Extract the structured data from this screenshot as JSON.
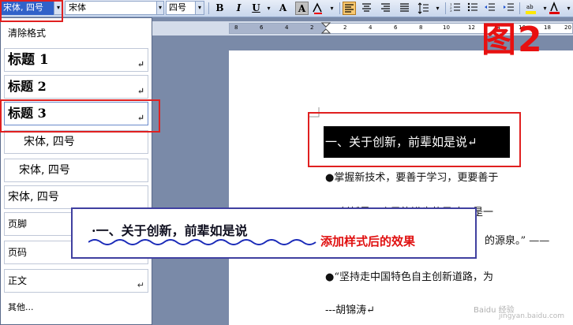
{
  "toolbar": {
    "style_value": "宋体, 四号",
    "font_value": "宋体",
    "size_value": "四号",
    "bold": "B",
    "italic": "I",
    "underline": "U",
    "font_color": "A",
    "char_border": "A",
    "dropdown_arrow": "▾",
    "icons": [
      "bold-icon",
      "italic-icon",
      "underline-icon",
      "font-color-icon",
      "char-shading-icon",
      "highlight-icon",
      "align-left-icon",
      "align-center-icon",
      "align-right-icon",
      "justify-icon",
      "line-spacing-icon",
      "numbering-icon",
      "bullets-icon",
      "decrease-indent-icon",
      "increase-indent-icon",
      "text-highlight-icon",
      "font-color-a-icon"
    ]
  },
  "ruler": {
    "numbers": [
      "8",
      "6",
      "4",
      "2",
      "2",
      "4",
      "6",
      "8",
      "10",
      "12",
      "14",
      "16",
      "18",
      "20"
    ]
  },
  "style_list": {
    "items": [
      {
        "label": "清除格式",
        "mark": ""
      },
      {
        "label": "标题 1",
        "mark": "↵"
      },
      {
        "label": "标题 2",
        "mark": "↵"
      },
      {
        "label": "标题 3",
        "mark": "↵"
      },
      {
        "label": "宋体, 四号",
        "mark": ""
      },
      {
        "label": "宋体, 四号",
        "mark": ""
      },
      {
        "label": "宋体, 四号",
        "mark": ""
      },
      {
        "label": "页脚",
        "mark": "↵"
      },
      {
        "label": "页码",
        "mark": ""
      },
      {
        "label": "正文",
        "mark": "↵"
      },
      {
        "label": "其他...",
        "mark": ""
      }
    ]
  },
  "document": {
    "heading": "一、关于创新，前辈如是说↵",
    "line1": "●掌握新技术，要善于学习，更要善于",
    "line2": "●“创新是一个民族进步的灵魂，是一",
    "line3": "的源泉。”  ——",
    "line4": "●“坚持走中国特色自主创新道路，为",
    "line5": "---胡锦涛↵"
  },
  "callout": {
    "text": "·一、关于创新，前辈如是说",
    "note": "添加样式后的效果"
  },
  "figure_label": "图2",
  "watermark": {
    "line1": "Baidu 经验",
    "line2": "jingyan.baidu.com"
  },
  "colors": {
    "accent_red": "#e02020",
    "selected_blue": "#3162c9",
    "callout_border": "#4040a0"
  }
}
